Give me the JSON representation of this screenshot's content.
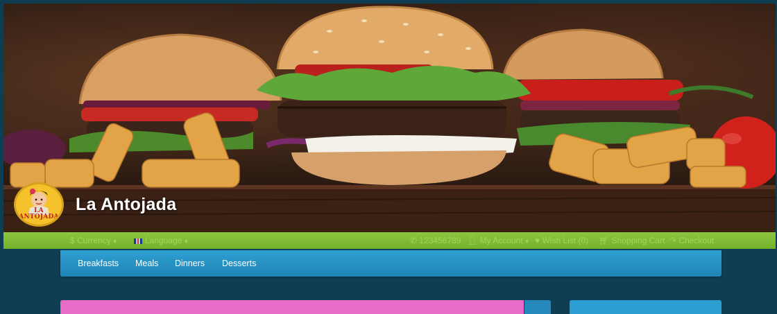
{
  "header": {
    "brand_name": "La Antojada",
    "logo_text": "LA ANTOJADA"
  },
  "topbar": {
    "currency_label": "$ Currency",
    "language_label": "Language",
    "phone": "123456789",
    "my_account": "My Account",
    "wish_list": "Wish List (0)",
    "shopping_cart": "Shopping Cart",
    "checkout": "Checkout"
  },
  "nav": {
    "items": [
      {
        "label": "Breakfasts"
      },
      {
        "label": "Meals"
      },
      {
        "label": "Dinners"
      },
      {
        "label": "Desserts"
      }
    ]
  },
  "icons": {
    "phone": "phone-icon",
    "account": "user-icon",
    "wishlist": "heart-icon",
    "cart": "cart-icon",
    "checkout": "share-icon"
  },
  "colors": {
    "topbar_green": "#8cc63f",
    "nav_blue": "#2f9fd1",
    "page_bg": "#0f3d52",
    "pink_panel": "#e86cc7"
  }
}
